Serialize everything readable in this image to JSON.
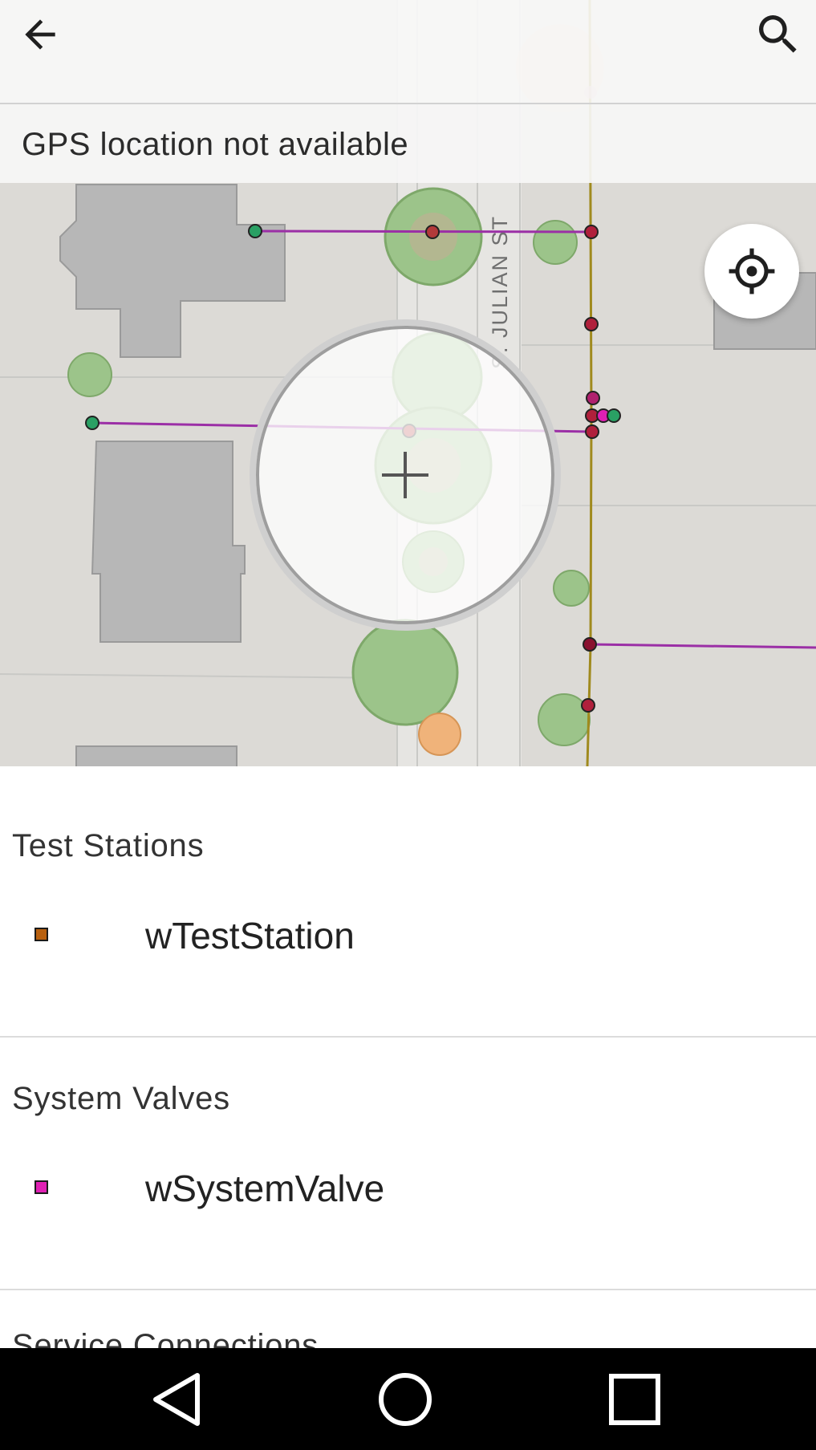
{
  "toolbar": {
    "back_icon": "arrow-back-icon",
    "search_icon": "search-icon"
  },
  "gps_banner": {
    "text": "GPS location not available"
  },
  "map": {
    "street_label": "S. JULIAN ST",
    "locate_icon": "crosshair-locate-icon",
    "colors": {
      "background": "#dcdad6",
      "building": "#b7b7b7",
      "pipe": "#9b2fa6",
      "main": "#a08a1e",
      "tree": "#9cc48a"
    }
  },
  "sheet": {
    "groups": [
      {
        "header": "Test Stations",
        "item": {
          "label": "wTestStation",
          "swatch_color": "#b8600f"
        }
      },
      {
        "header": "System Valves",
        "item": {
          "label": "wSystemValve",
          "swatch_color": "#e020b4"
        }
      },
      {
        "header": "Service Connections"
      }
    ]
  },
  "navbar": {
    "back": "nav-back-icon",
    "home": "nav-home-icon",
    "recents": "nav-recents-icon"
  }
}
